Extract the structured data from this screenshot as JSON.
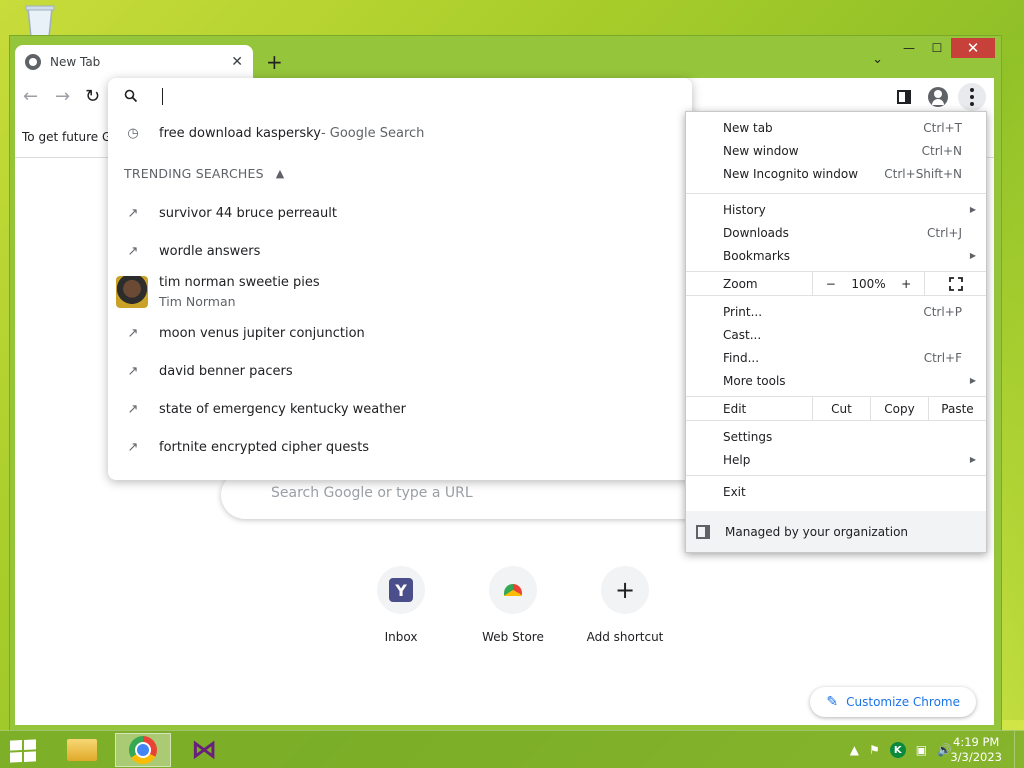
{
  "window": {
    "tab_title": "New Tab",
    "tab_close": "✕",
    "new_tab": "+",
    "tab_search": "⌄",
    "minimize": "—",
    "maximize": "☐",
    "close": "✕"
  },
  "toolbar": {
    "back": "←",
    "forward": "→",
    "reload": "↻"
  },
  "infobar": {
    "text": "To get future G"
  },
  "omnibox": {
    "input_value": "",
    "history": {
      "text": "free download kaspersky",
      "sub": " - Google Search"
    },
    "trending_header": "TRENDING SEARCHES",
    "trending": [
      "survivor 44 bruce perreault",
      "wordle answers"
    ],
    "rich": {
      "title": "tim norman sweetie pies",
      "subtitle": "Tim Norman"
    },
    "trending_more": [
      "moon venus jupiter conjunction",
      "david benner pacers",
      "state of emergency kentucky weather",
      "fortnite encrypted cipher quests"
    ]
  },
  "ntp": {
    "search_placeholder": "Search Google or type a URL",
    "shortcuts": [
      {
        "label": "Inbox"
      },
      {
        "label": "Web Store"
      },
      {
        "label": "Add shortcut"
      }
    ],
    "customize": "Customize Chrome"
  },
  "menu": {
    "new_tab": {
      "label": "New tab",
      "key": "Ctrl+T"
    },
    "new_window": {
      "label": "New window",
      "key": "Ctrl+N"
    },
    "incognito": {
      "label": "New Incognito window",
      "key": "Ctrl+Shift+N"
    },
    "history": {
      "label": "History"
    },
    "downloads": {
      "label": "Downloads",
      "key": "Ctrl+J"
    },
    "bookmarks": {
      "label": "Bookmarks"
    },
    "zoom": {
      "label": "Zoom",
      "minus": "−",
      "value": "100%",
      "plus": "+"
    },
    "print": {
      "label": "Print...",
      "key": "Ctrl+P"
    },
    "cast": {
      "label": "Cast..."
    },
    "find": {
      "label": "Find...",
      "key": "Ctrl+F"
    },
    "more_tools": {
      "label": "More tools"
    },
    "edit": {
      "label": "Edit",
      "cut": "Cut",
      "copy": "Copy",
      "paste": "Paste"
    },
    "settings": {
      "label": "Settings"
    },
    "help": {
      "label": "Help"
    },
    "exit": {
      "label": "Exit"
    },
    "managed": "Managed by your organization"
  },
  "taskbar": {
    "time": "4:19 PM",
    "date": "3/3/2023"
  }
}
